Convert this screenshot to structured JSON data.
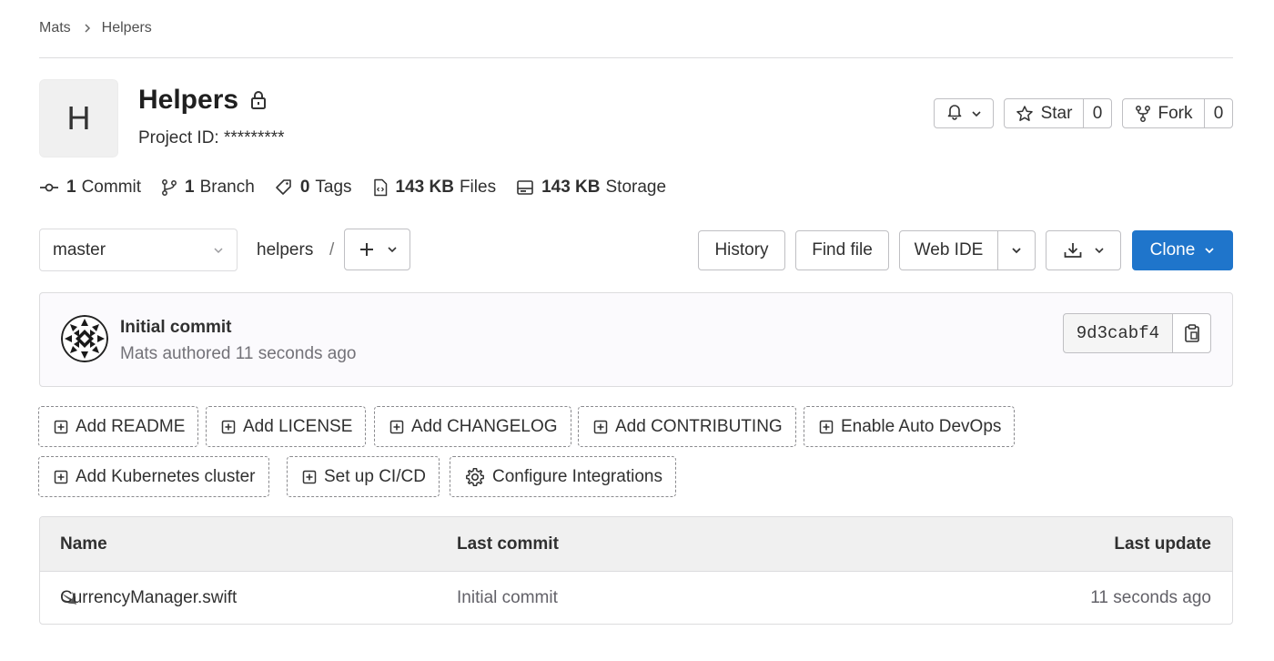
{
  "breadcrumb": {
    "parent": "Mats",
    "current": "Helpers"
  },
  "project": {
    "avatar_letter": "H",
    "title": "Helpers",
    "id_label": "Project ID: *********"
  },
  "actions": {
    "notification_icon": "bell-icon",
    "star_label": "Star",
    "star_count": "0",
    "fork_label": "Fork",
    "fork_count": "0"
  },
  "stats": {
    "commits_count": "1",
    "commits_label": "Commit",
    "branches_count": "1",
    "branches_label": "Branch",
    "tags_count": "0",
    "tags_label": "Tags",
    "files_size": "143 KB",
    "files_label": "Files",
    "storage_size": "143 KB",
    "storage_label": "Storage"
  },
  "repo_nav": {
    "branch": "master",
    "path": "helpers",
    "path_separator": "/",
    "history_label": "History",
    "find_file_label": "Find file",
    "web_ide_label": "Web IDE",
    "clone_label": "Clone"
  },
  "last_commit": {
    "title": "Initial commit",
    "meta": "Mats authored 11 seconds ago",
    "sha": "9d3cabf4"
  },
  "quick_actions": [
    "Add README",
    "Add LICENSE",
    "Add CHANGELOG",
    "Add CONTRIBUTING",
    "Enable Auto DevOps",
    "Add Kubernetes cluster",
    "Set up CI/CD",
    "Configure Integrations"
  ],
  "file_table": {
    "headers": {
      "name": "Name",
      "last_commit": "Last commit",
      "last_update": "Last update"
    },
    "rows": [
      {
        "name": "CurrencyManager.swift",
        "last_commit": "Initial commit",
        "last_update": "11 seconds ago",
        "icon": "swift-icon"
      }
    ]
  },
  "colors": {
    "primary": "#1f75cb",
    "border": "#bfbfc3",
    "muted_text": "#737278"
  }
}
